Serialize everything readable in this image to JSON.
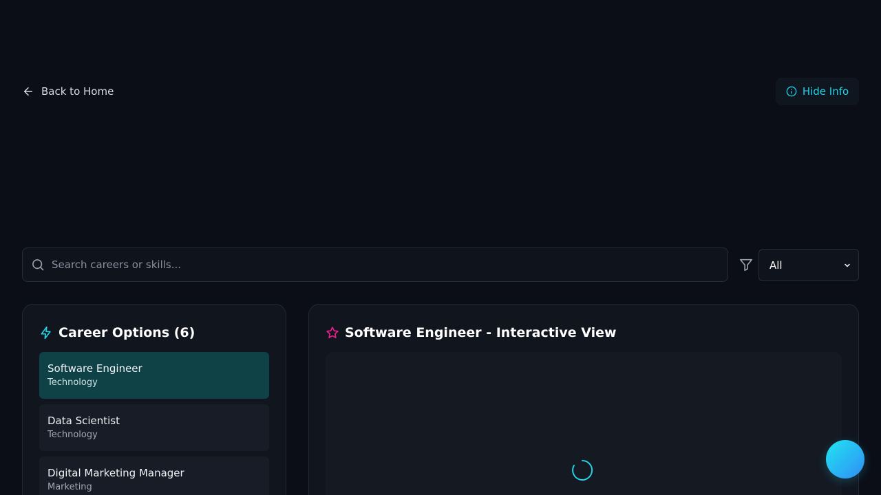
{
  "nav": {
    "back_label": "Back to Home",
    "hide_info_label": "Hide Info"
  },
  "search": {
    "placeholder": "Search careers or skills...",
    "value": ""
  },
  "filter": {
    "selected": "All"
  },
  "career_panel": {
    "title": "Career Options (6)",
    "items": [
      {
        "name": "Software Engineer",
        "category": "Technology",
        "active": true
      },
      {
        "name": "Data Scientist",
        "category": "Technology",
        "active": false
      },
      {
        "name": "Digital Marketing Manager",
        "category": "Marketing",
        "active": false
      }
    ]
  },
  "detail_panel": {
    "title": "Software Engineer - Interactive View"
  },
  "colors": {
    "accent_cyan": "#22d3e6",
    "accent_pink": "#ec1f8c",
    "active_item_bg": "#0f4247",
    "background": "#0b0e17"
  },
  "icons": {
    "back": "arrow-left-icon",
    "info": "info-icon",
    "search": "search-icon",
    "filter": "filter-icon",
    "select": "chevron-down-icon",
    "career_title": "lightning-icon",
    "detail_title": "star-icon",
    "loading": "spinner-icon"
  }
}
